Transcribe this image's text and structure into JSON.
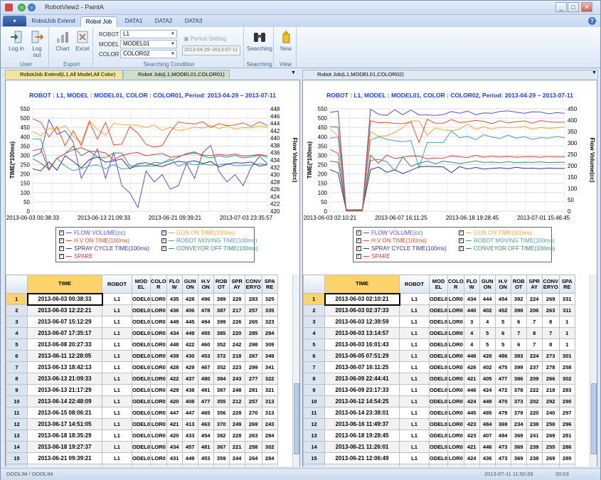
{
  "window": {
    "title": "RobotView2 - PaintA",
    "min": "_",
    "max": "□",
    "close": "✕"
  },
  "ribbon_tabs": [
    "RobotJob Extend",
    "Robot Job",
    "DATA1",
    "DATA2",
    "DATA3"
  ],
  "ribbon": {
    "user": {
      "login": "Log in",
      "logout": "Log out",
      "label": "User"
    },
    "export": {
      "chart": "Chart",
      "excel": "Excel",
      "label": "Export"
    },
    "search": {
      "robot_label": "ROBOT",
      "robot_value": "L1",
      "model_label": "MODEL",
      "model_value": "MODEL01",
      "color_label": "COLOR",
      "color_value": "COLOR02",
      "period_setting": "Period Setting",
      "period": "2013-04-29~2013-07-11",
      "label": "Searching Condition"
    },
    "searching": {
      "btn": "Searching",
      "label": "Searching"
    },
    "view": {
      "btn": "New",
      "label": "View"
    }
  },
  "doc_tabs": {
    "left1": "RobotJob Extend(L1,All Model,All Color)",
    "left2": "Robot Job(L1,MODEL01,COLOR01)",
    "right1": "Robot Job(L1,MODEL01,COLOR02)"
  },
  "legend": [
    "FLOW VOLUME(cc)",
    "GUN ON TIME(100ms)",
    "H.V ON TIME(100ms)",
    "ROBOT MOVING TIME(100ms)",
    "SPRAY CYCLE TIME(100ms)",
    "CONVEYOR OFF TIME(100ms)",
    "SPARE"
  ],
  "series_colors": [
    "#5555cc",
    "#f4a53c",
    "#e05030",
    "#4aa0b0",
    "#333399",
    "#3a8a6a",
    "#d04040"
  ],
  "grid_headers": [
    "TIME",
    "ROBOT",
    "MOD EL",
    "COLO R",
    "FLO W",
    "GUN ON",
    "H.V ON",
    "ROB OT",
    "SPR AY",
    "CONV ERYO",
    "SPA RE"
  ],
  "left": {
    "chart_data": {
      "type": "line",
      "title": "ROBOT : L1, MODEL : MODEL01, COLOR : COLOR01, Period: 2013-04-29 ~ 2013-07-11",
      "ylabel": "TIME(*100ms)",
      "y2label": "Flow Volume(cc)",
      "ylim": [
        0,
        550
      ],
      "y2lim": [
        420,
        448
      ],
      "yticks": [
        "550",
        "500",
        "450",
        "400",
        "350",
        "300",
        "250",
        "200",
        "150",
        "100",
        "50",
        "0"
      ],
      "y2ticks": [
        "448",
        "446",
        "444",
        "442",
        "440",
        "438",
        "436",
        "434",
        "432",
        "430",
        "428",
        "426",
        "424",
        "422",
        "420"
      ],
      "xticks": [
        "2013-06-03 00:38:33",
        "2013-06-13 21:09:33",
        "2013-06-21 09:39:21",
        "2013-07-03 23:35:57"
      ],
      "series": [
        {
          "name": "FLOW VOLUME(cc)",
          "axis": "right",
          "values": [
            435,
            436,
            445,
            441,
            442,
            439,
            429,
            433,
            437,
            429,
            436,
            427,
            425,
            421,
            431,
            428,
            430,
            426,
            427,
            433,
            429,
            436,
            438,
            431,
            428,
            430,
            427,
            432,
            435,
            433
          ]
        },
        {
          "name": "GUN ON TIME(100ms)",
          "axis": "left",
          "values": [
            428,
            406,
            444,
            439,
            460,
            403,
            367,
            487,
            438,
            408,
            472,
            465,
            463,
            462,
            449,
            463,
            433,
            451,
            432,
            440,
            452,
            446,
            461,
            443,
            458,
            440,
            450,
            447,
            458,
            452
          ]
        },
        {
          "name": "H.V ON TIME(100ms)",
          "axis": "left",
          "values": [
            496,
            478,
            399,
            455,
            352,
            432,
            352,
            480,
            387,
            477,
            356,
            360,
            454,
            419,
            359,
            344,
            352,
            427,
            479,
            472,
            469,
            480,
            450,
            470,
            460,
            463,
            475,
            455,
            480,
            460
          ]
        },
        {
          "name": "ROBOT MOVING TIME(100ms)",
          "axis": "left",
          "values": [
            389,
            387,
            226,
            285,
            242,
            218,
            229,
            243,
            248,
            228,
            250,
            227,
            231,
            241,
            244,
            241,
            259,
            282,
            240,
            258,
            249,
            252,
            247,
            250,
            256,
            244,
            246,
            248,
            255,
            251
          ]
        },
        {
          "name": "SPRAY CYCLE TIME(100ms)",
          "axis": "left",
          "values": [
            228,
            217,
            265,
            220,
            298,
            267,
            233,
            277,
            291,
            263,
            270,
            281,
            228,
            255,
            261,
            248,
            239,
            256,
            268,
            262,
            271,
            256,
            267,
            238,
            252,
            261,
            259,
            264,
            242,
            250
          ]
        },
        {
          "name": "CONVEYOR OFF TIME(100ms)",
          "axis": "left",
          "values": [
            283,
            257,
            226,
            285,
            309,
            349,
            299,
            322,
            291,
            287,
            313,
            313,
            243,
            244,
            243,
            262,
            259,
            271,
            290,
            310,
            318,
            296,
            286,
            298,
            290,
            300,
            286,
            292,
            301,
            290
          ]
        },
        {
          "name": "SPARE",
          "axis": "left",
          "values": [
            325,
            335,
            220,
            285,
            309,
            330,
            341,
            322,
            321,
            313,
            275,
            300,
            310,
            315,
            298,
            305,
            310,
            290,
            295,
            305,
            312,
            302,
            298,
            306,
            300,
            308,
            296,
            300,
            304,
            298
          ]
        }
      ]
    },
    "rows": [
      [
        "1",
        "2013-06-03 00:38:33",
        "L1",
        "ODEL0",
        "LOR0",
        "435",
        "428",
        "496",
        "389",
        "228",
        "283",
        "325"
      ],
      [
        "2",
        "2013-06-03 12:22:21",
        "L1",
        "ODEL0",
        "LOR0",
        "436",
        "406",
        "478",
        "387",
        "217",
        "257",
        "335"
      ],
      [
        "3",
        "2013-06-07 15:12:29",
        "L1",
        "ODEL0",
        "LOR0",
        "449",
        "445",
        "494",
        "399",
        "226",
        "265",
        "323"
      ],
      [
        "4",
        "2013-06-07 17:35:17",
        "L1",
        "ODEL0",
        "LOR0",
        "434",
        "449",
        "455",
        "385",
        "220",
        "285",
        "284"
      ],
      [
        "5",
        "2013-06-08 20:27:33",
        "L1",
        "ODEL0",
        "LOR0",
        "448",
        "422",
        "460",
        "352",
        "242",
        "298",
        "309"
      ],
      [
        "6",
        "2013-06-11 12:28:05",
        "L1",
        "ODEL0",
        "LOR0",
        "439",
        "430",
        "453",
        "372",
        "218",
        "267",
        "349"
      ],
      [
        "7",
        "2013-06-13 18:42:13",
        "L1",
        "ODEL0",
        "LOR0",
        "428",
        "429",
        "467",
        "352",
        "223",
        "299",
        "341"
      ],
      [
        "8",
        "2013-06-13 21:09:33",
        "L1",
        "ODEL0",
        "LOR0",
        "422",
        "437",
        "480",
        "384",
        "243",
        "277",
        "322"
      ],
      [
        "9",
        "2013-06-13 21:17:29",
        "L1",
        "ODEL0",
        "LOR0",
        "429",
        "438",
        "491",
        "387",
        "248",
        "291",
        "321"
      ],
      [
        "10",
        "2013-06-14 22:48:09",
        "L1",
        "ODEL0",
        "LOR0",
        "420",
        "408",
        "477",
        "355",
        "212",
        "257",
        "313"
      ],
      [
        "11",
        "2013-06-15 08:06:21",
        "L1",
        "ODEL0",
        "LOR0",
        "447",
        "447",
        "465",
        "356",
        "228",
        "270",
        "313"
      ],
      [
        "12",
        "2013-06-17 14:51:05",
        "L1",
        "ODEL0",
        "LOR0",
        "421",
        "413",
        "463",
        "370",
        "249",
        "269",
        "243"
      ],
      [
        "13",
        "2013-06-18 18:35:29",
        "L1",
        "ODEL0",
        "LOR0",
        "420",
        "433",
        "454",
        "382",
        "228",
        "263",
        "284"
      ],
      [
        "14",
        "2013-06-18 19:27:37",
        "L1",
        "ODEL0",
        "LOR0",
        "434",
        "457",
        "481",
        "367",
        "221",
        "258",
        "302"
      ],
      [
        "15",
        "2013-06-21 09:39:21",
        "L1",
        "ODEL0",
        "LOR0",
        "431",
        "449",
        "453",
        "359",
        "244",
        "264",
        "284"
      ],
      [
        "16",
        "2013-06-23 18:53:41",
        "L1",
        "ODEL0",
        "LOR0",
        "427",
        "403",
        "468",
        "359",
        "232",
        "259",
        "309"
      ],
      [
        "17",
        "2013-06-23 19:49:13",
        "L1",
        "ODEL0",
        "LOR0",
        "426",
        "433",
        "472",
        "392",
        "248",
        "290",
        "313"
      ]
    ]
  },
  "right": {
    "chart_data": {
      "type": "line",
      "title": "ROBOT : L1, MODEL : MODEL01, COLOR : COLOR02, Period: 2013-04-29 ~ 2013-07-11",
      "ylabel": "TIME(*100ms)",
      "y2label": "Flow Volume(cc)",
      "ylim": [
        0,
        550
      ],
      "y2lim": [
        0,
        450
      ],
      "yticks": [
        "550",
        "500",
        "450",
        "400",
        "350",
        "300",
        "250",
        "200",
        "150",
        "100",
        "50",
        "0"
      ],
      "y2ticks": [
        "450",
        "400",
        "350",
        "300",
        "250",
        "200",
        "150",
        "100",
        "50",
        "0"
      ],
      "xticks": [
        "2013-06-03 02:10:21",
        "2013-06-07 16:11:25",
        "2013-06-18 19:28:45",
        "2013-07-01 15:46:45"
      ],
      "series": [
        {
          "name": "FLOW VOLUME(cc)",
          "axis": "right",
          "values": [
            434,
            440,
            3,
            4,
            4,
            448,
            426,
            421,
            446,
            424,
            445,
            423,
            423,
            421,
            424,
            438,
            430,
            440,
            424,
            432,
            430,
            438,
            441,
            435,
            430,
            437,
            436,
            428,
            433,
            430
          ]
        },
        {
          "name": "GUN ON TIME(100ms)",
          "axis": "left",
          "values": [
            444,
            402,
            5,
            5,
            5,
            428,
            402,
            405,
            424,
            449,
            485,
            484,
            407,
            446,
            436,
            432,
            441,
            468,
            439,
            453,
            440,
            452,
            449,
            450,
            456,
            440,
            450,
            445,
            448,
            452
          ]
        },
        {
          "name": "H.V ON TIME(100ms)",
          "axis": "left",
          "values": [
            454,
            452,
            6,
            5,
            5,
            486,
            475,
            477,
            472,
            470,
            479,
            369,
            494,
            473,
            473,
            492,
            476,
            480,
            488,
            482,
            470,
            486,
            474,
            481,
            485,
            473,
            487,
            480,
            478,
            478
          ]
        },
        {
          "name": "ROBOT MOVING TIME(100ms)",
          "axis": "left",
          "values": [
            392,
            398,
            7,
            7,
            7,
            383,
            399,
            386,
            378,
            373,
            379,
            234,
            369,
            369,
            369,
            431,
            395,
            402,
            384,
            411,
            398,
            390,
            409,
            392,
            400,
            386,
            395,
            392,
            401,
            394
          ]
        },
        {
          "name": "SPRAY CYCLE TIME(100ms)",
          "axis": "left",
          "values": [
            224,
            206,
            7,
            8,
            8,
            224,
            237,
            209,
            222,
            202,
            220,
            238,
            241,
            239,
            238,
            207,
            240,
            227,
            235,
            226,
            230,
            233,
            228,
            236,
            230,
            231,
            228,
            232,
            229,
            230
          ]
        },
        {
          "name": "CONVEYOR OFF TIME(100ms)",
          "axis": "left",
          "values": [
            269,
            263,
            8,
            7,
            7,
            273,
            278,
            266,
            218,
            292,
            240,
            258,
            269,
            255,
            269,
            263,
            256,
            262,
            270,
            262,
            264,
            260,
            266,
            261,
            263,
            262,
            265,
            261,
            263,
            262
          ]
        },
        {
          "name": "SPARE",
          "axis": "left",
          "values": [
            331,
            311,
            1,
            1,
            1,
            301,
            258,
            302,
            283,
            290,
            297,
            296,
            281,
            286,
            285,
            297,
            292,
            288,
            300,
            290,
            295,
            291,
            294,
            290,
            292,
            293,
            290,
            294,
            291,
            292
          ]
        }
      ]
    },
    "rows": [
      [
        "1",
        "2013-06-03 02:10:21",
        "L1",
        "ODEL0",
        "LOR0",
        "434",
        "444",
        "454",
        "392",
        "224",
        "269",
        "331"
      ],
      [
        "2",
        "2013-06-03 02:37:33",
        "L1",
        "ODEL0",
        "LOR0",
        "440",
        "402",
        "452",
        "398",
        "206",
        "263",
        "311"
      ],
      [
        "3",
        "2013-06-03 12:39:59",
        "L1",
        "ODEL0",
        "LOR0",
        "3",
        "4",
        "5",
        "6",
        "7",
        "8",
        "1"
      ],
      [
        "4",
        "2013-06-03 13:14:57",
        "L1",
        "ODEL0",
        "LOR0",
        "4",
        "5",
        "6",
        "7",
        "8",
        "7",
        "1"
      ],
      [
        "5",
        "2013-06-03 16:01:43",
        "L1",
        "ODEL0",
        "LOR0",
        "4",
        "5",
        "5",
        "6",
        "7",
        "8",
        "1"
      ],
      [
        "6",
        "2013-06-05 07:51:29",
        "L1",
        "ODEL0",
        "LOR0",
        "448",
        "428",
        "486",
        "383",
        "224",
        "273",
        "301"
      ],
      [
        "7",
        "2013-06-07 16:11:25",
        "L1",
        "ODEL0",
        "LOR0",
        "426",
        "402",
        "475",
        "399",
        "237",
        "278",
        "258"
      ],
      [
        "8",
        "2013-06-09 22:44:41",
        "L1",
        "ODEL0",
        "LOR0",
        "421",
        "405",
        "477",
        "386",
        "209",
        "266",
        "302"
      ],
      [
        "9",
        "2013-06-09 23:17:33",
        "L1",
        "ODEL0",
        "LOR0",
        "446",
        "424",
        "472",
        "378",
        "222",
        "218",
        "283"
      ],
      [
        "10",
        "2013-06-12 14:54:25",
        "L1",
        "ODEL0",
        "LOR0",
        "424",
        "449",
        "470",
        "373",
        "202",
        "292",
        "290"
      ],
      [
        "11",
        "2013-06-14 23:38:01",
        "L1",
        "ODEL0",
        "LOR0",
        "445",
        "485",
        "479",
        "379",
        "220",
        "240",
        "297"
      ],
      [
        "12",
        "2013-06-16 11:49:37",
        "L1",
        "ODEL0",
        "LOR0",
        "423",
        "484",
        "369",
        "234",
        "238",
        "258",
        "296"
      ],
      [
        "13",
        "2013-06-18 19:28:45",
        "L1",
        "ODEL0",
        "LOR0",
        "423",
        "407",
        "494",
        "369",
        "241",
        "269",
        "281"
      ],
      [
        "14",
        "2013-06-21 11:26:01",
        "L1",
        "ODEL0",
        "LOR0",
        "421",
        "446",
        "473",
        "369",
        "239",
        "255",
        "286"
      ],
      [
        "15",
        "2013-06-21 12:06:49",
        "L1",
        "ODEL0",
        "LOR0",
        "424",
        "436",
        "473",
        "369",
        "238",
        "269",
        "285"
      ],
      [
        "16",
        "2013-06-23 14:55:53",
        "L1",
        "ODEL0",
        "LOR0",
        "438",
        "432",
        "492",
        "431",
        "207",
        "263",
        "297"
      ],
      [
        "17",
        "2013-06-26 08:22:21",
        "L1",
        "ODEL0",
        "LOR0",
        "430",
        "441",
        "476",
        "395",
        "240",
        "256",
        "292"
      ]
    ]
  },
  "status": {
    "left": "DOOLIM / DOOLIM",
    "datetime": "2013-07-11 11:50:39",
    "elapsed": "00:03"
  }
}
